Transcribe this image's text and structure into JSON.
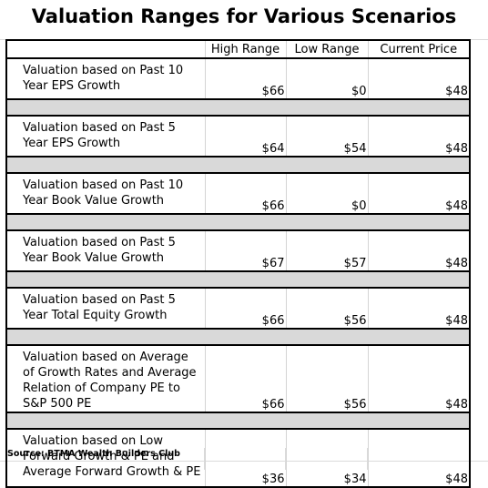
{
  "title": "Valuation Ranges for Various Scenarios",
  "columns": [
    "",
    "High Range",
    "Low Range",
    "Current Price"
  ],
  "rows": [
    {
      "label": "Valuation based on Past 10 Year EPS Growth",
      "high": "$66",
      "low": "$0",
      "current": "$48"
    },
    {
      "label": "Valuation based on Past 5 Year EPS Growth",
      "high": "$64",
      "low": "$54",
      "current": "$48"
    },
    {
      "label": "Valuation based on Past 10 Year Book Value Growth",
      "high": "$66",
      "low": "$0",
      "current": "$48"
    },
    {
      "label": "Valuation based on Past 5 Year Book Value Growth",
      "high": "$67",
      "low": "$57",
      "current": "$48"
    },
    {
      "label": "Valuation based on Past 5 Year Total Equity Growth",
      "high": "$66",
      "low": "$56",
      "current": "$48"
    },
    {
      "label": "Valuation based on Average of Growth Rates and Average Relation of Company PE to S&P 500 PE",
      "high": "$66",
      "low": "$56",
      "current": "$48"
    },
    {
      "label": "Valuation based on Low Forward Growth & PE and Average Forward Growth & PE",
      "high": "$36",
      "low": "$34",
      "current": "$48"
    }
  ],
  "source": "Source: BTMA Wealth Builders Club"
}
